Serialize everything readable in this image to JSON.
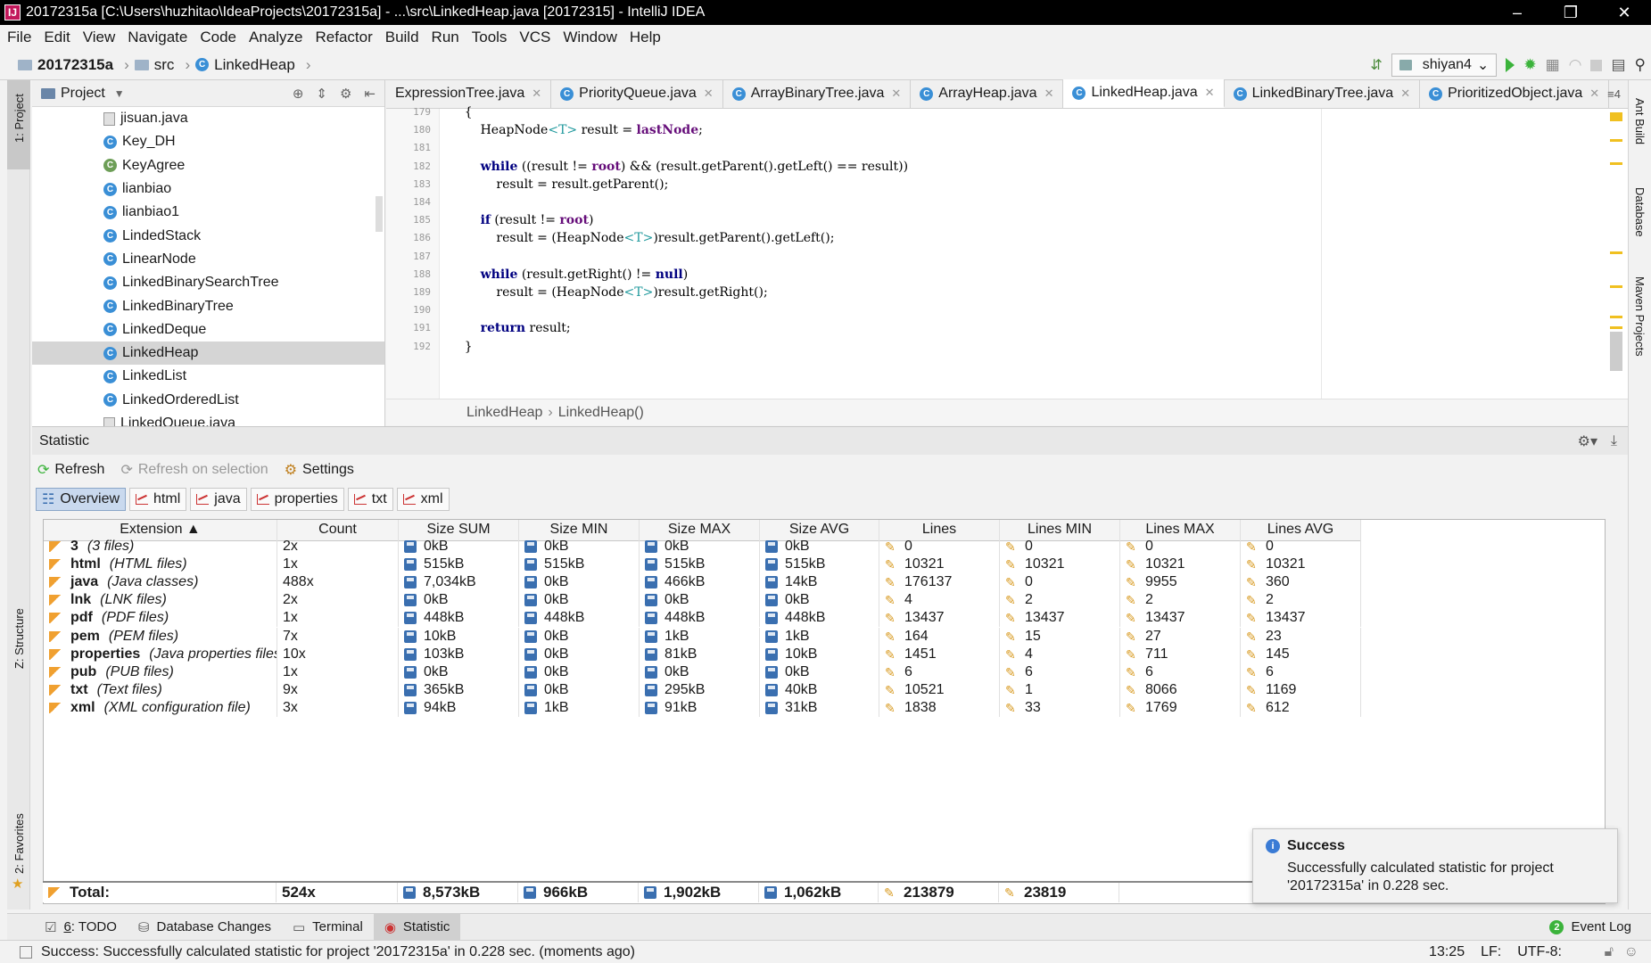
{
  "window": {
    "title": "20172315a [C:\\Users\\huzhitao\\IdeaProjects\\20172315a] - ...\\src\\LinkedHeap.java [20172315] - IntelliJ IDEA",
    "controls": [
      "–",
      "❐",
      "✕"
    ]
  },
  "menu": [
    "File",
    "Edit",
    "View",
    "Navigate",
    "Code",
    "Analyze",
    "Refactor",
    "Build",
    "Run",
    "Tools",
    "VCS",
    "Window",
    "Help"
  ],
  "nav": {
    "project": "20172315a",
    "folder": "src",
    "file": "LinkedHeap",
    "run_config": "shiyan4"
  },
  "left_strip": {
    "project": "1: Project",
    "structure": "Z: Structure",
    "favorites": "2: Favorites"
  },
  "right_strip": {
    "ant": "Ant Build",
    "database": "Database",
    "maven": "Maven Projects"
  },
  "project_panel": {
    "title": "Project",
    "items": [
      {
        "label": "jisuan.java",
        "kind": "file"
      },
      {
        "label": "Key_DH",
        "kind": "class"
      },
      {
        "label": "KeyAgree",
        "kind": "class-main"
      },
      {
        "label": "lianbiao",
        "kind": "class"
      },
      {
        "label": "lianbiao1",
        "kind": "class"
      },
      {
        "label": "LindedStack",
        "kind": "class"
      },
      {
        "label": "LinearNode",
        "kind": "class"
      },
      {
        "label": "LinkedBinarySearchTree",
        "kind": "class"
      },
      {
        "label": "LinkedBinaryTree",
        "kind": "class"
      },
      {
        "label": "LinkedDeque",
        "kind": "class"
      },
      {
        "label": "LinkedHeap",
        "kind": "class",
        "selected": true
      },
      {
        "label": "LinkedList",
        "kind": "class"
      },
      {
        "label": "LinkedOrderedList",
        "kind": "class"
      },
      {
        "label": "LinkedQueue.java",
        "kind": "file"
      }
    ]
  },
  "editor_tabs": [
    {
      "label": "ExpressionTree.java",
      "active": false
    },
    {
      "label": "PriorityQueue.java",
      "active": false
    },
    {
      "label": "ArrayBinaryTree.java",
      "active": false
    },
    {
      "label": "ArrayHeap.java",
      "active": false
    },
    {
      "label": "LinkedHeap.java",
      "active": true
    },
    {
      "label": "LinkedBinaryTree.java",
      "active": false
    },
    {
      "label": "PrioritizedObject.java",
      "active": false
    }
  ],
  "tabs_overflow": "4",
  "editor": {
    "line_numbers": [
      "179",
      "180",
      "181",
      "182",
      "183",
      "184",
      "185",
      "186",
      "187",
      "188",
      "189",
      "190",
      "191",
      "192"
    ],
    "lines": [
      "    {",
      "        HeapNode<T> result = lastNode;",
      "",
      "        while ((result != root) && (result.getParent().getLeft() == result))",
      "            result = result.getParent();",
      "",
      "        if (result != root)",
      "            result = (HeapNode<T>)result.getParent().getLeft();",
      "",
      "        while (result.getRight() != null)",
      "            result = (HeapNode<T>)result.getRight();",
      "",
      "        return result;",
      "    }"
    ],
    "breadcrumb": [
      "LinkedHeap",
      "LinkedHeap()"
    ]
  },
  "statistic": {
    "title": "Statistic",
    "toolbar": {
      "refresh": "Refresh",
      "refresh_on_selection": "Refresh on selection",
      "settings": "Settings"
    },
    "tabs": [
      "Overview",
      "html",
      "java",
      "properties",
      "txt",
      "xml"
    ],
    "columns": [
      "Extension ▲",
      "Count",
      "Size SUM",
      "Size MIN",
      "Size MAX",
      "Size AVG",
      "Lines",
      "Lines MIN",
      "Lines MAX",
      "Lines AVG"
    ],
    "rows": [
      {
        "ext": "3",
        "desc": "(3 files)",
        "count": "2x",
        "ssum": "0kB",
        "smin": "0kB",
        "smax": "0kB",
        "savg": "0kB",
        "lines": "0",
        "lmin": "0",
        "lmax": "0",
        "lavg": "0"
      },
      {
        "ext": "html",
        "desc": "(HTML files)",
        "count": "1x",
        "ssum": "515kB",
        "smin": "515kB",
        "smax": "515kB",
        "savg": "515kB",
        "lines": "10321",
        "lmin": "10321",
        "lmax": "10321",
        "lavg": "10321"
      },
      {
        "ext": "java",
        "desc": "(Java classes)",
        "count": "488x",
        "ssum": "7,034kB",
        "smin": "0kB",
        "smax": "466kB",
        "savg": "14kB",
        "lines": "176137",
        "lmin": "0",
        "lmax": "9955",
        "lavg": "360"
      },
      {
        "ext": "lnk",
        "desc": "(LNK files)",
        "count": "2x",
        "ssum": "0kB",
        "smin": "0kB",
        "smax": "0kB",
        "savg": "0kB",
        "lines": "4",
        "lmin": "2",
        "lmax": "2",
        "lavg": "2"
      },
      {
        "ext": "pdf",
        "desc": "(PDF files)",
        "count": "1x",
        "ssum": "448kB",
        "smin": "448kB",
        "smax": "448kB",
        "savg": "448kB",
        "lines": "13437",
        "lmin": "13437",
        "lmax": "13437",
        "lavg": "13437"
      },
      {
        "ext": "pem",
        "desc": "(PEM files)",
        "count": "7x",
        "ssum": "10kB",
        "smin": "0kB",
        "smax": "1kB",
        "savg": "1kB",
        "lines": "164",
        "lmin": "15",
        "lmax": "27",
        "lavg": "23"
      },
      {
        "ext": "properties",
        "desc": "(Java properties files)",
        "count": "10x",
        "ssum": "103kB",
        "smin": "0kB",
        "smax": "81kB",
        "savg": "10kB",
        "lines": "1451",
        "lmin": "4",
        "lmax": "711",
        "lavg": "145"
      },
      {
        "ext": "pub",
        "desc": "(PUB files)",
        "count": "1x",
        "ssum": "0kB",
        "smin": "0kB",
        "smax": "0kB",
        "savg": "0kB",
        "lines": "6",
        "lmin": "6",
        "lmax": "6",
        "lavg": "6"
      },
      {
        "ext": "txt",
        "desc": "(Text files)",
        "count": "9x",
        "ssum": "365kB",
        "smin": "0kB",
        "smax": "295kB",
        "savg": "40kB",
        "lines": "10521",
        "lmin": "1",
        "lmax": "8066",
        "lavg": "1169"
      },
      {
        "ext": "xml",
        "desc": "(XML configuration file)",
        "count": "3x",
        "ssum": "94kB",
        "smin": "1kB",
        "smax": "91kB",
        "savg": "31kB",
        "lines": "1838",
        "lmin": "33",
        "lmax": "1769",
        "lavg": "612"
      }
    ],
    "total": {
      "label": "Total:",
      "count": "524x",
      "ssum": "8,573kB",
      "smin": "966kB",
      "smax": "1,902kB",
      "savg": "1,062kB",
      "lines": "213879",
      "lmin": "23819"
    }
  },
  "toast": {
    "title": "Success",
    "message": "Successfully calculated statistic for project '20172315a' in 0.228 sec."
  },
  "bottom_tabs": {
    "todo_num": "6",
    "todo": "TODO",
    "db": "Database Changes",
    "terminal": "Terminal",
    "statistic": "Statistic",
    "event_num": "2",
    "event": "Event Log"
  },
  "status": {
    "message": "Success: Successfully calculated statistic for project '20172315a' in 0.228 sec. (moments ago)",
    "pos": "13:25",
    "lf": "LF:",
    "enc": "UTF-8:"
  }
}
